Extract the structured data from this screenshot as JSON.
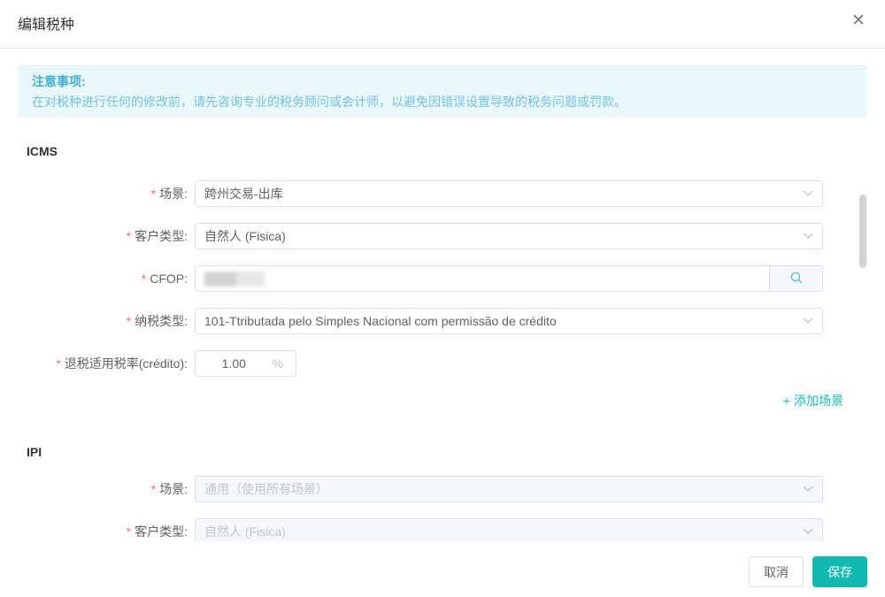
{
  "modal": {
    "title": "编辑税种",
    "close_glyph": "✕"
  },
  "marks": {
    "required": "*"
  },
  "notice": {
    "title": "注意事项:",
    "body": "在对税种进行任何的修改前，请先咨询专业的税务顾问或会计师，以避免因错误设置导致的税务问题或罚款。"
  },
  "icms": {
    "section_title": "ICMS",
    "fields": {
      "scene": {
        "label": "场景:",
        "value": "跨州交易-出库"
      },
      "customer_type": {
        "label": "客户类型:",
        "value": "自然人 (Fisica)"
      },
      "cfop": {
        "label": "CFOP:",
        "value": "",
        "redacted": true
      },
      "tax_type": {
        "label": "纳税类型:",
        "value": "101-Ttributada pelo Simples Nacional com permissão de crédito"
      },
      "credit_rate": {
        "label": "退税适用税率(crédito):",
        "value": "1.00",
        "suffix": "%"
      }
    },
    "add_scene_link": "+ 添加场景"
  },
  "ipi": {
    "section_title": "IPI",
    "fields": {
      "scene": {
        "label": "场景:",
        "value": "通用（使用所有场景）",
        "disabled": true
      },
      "customer_type": {
        "label": "客户类型:",
        "value": "自然人 (Fisica)",
        "disabled": true
      }
    }
  },
  "footer": {
    "cancel_label": "取消",
    "save_label": "保存"
  },
  "colors": {
    "accent_teal": "#0fbab2",
    "notice_text": "#41b1d5",
    "required_red": "#f56c6c",
    "disabled_bg": "#f5f7fa"
  }
}
